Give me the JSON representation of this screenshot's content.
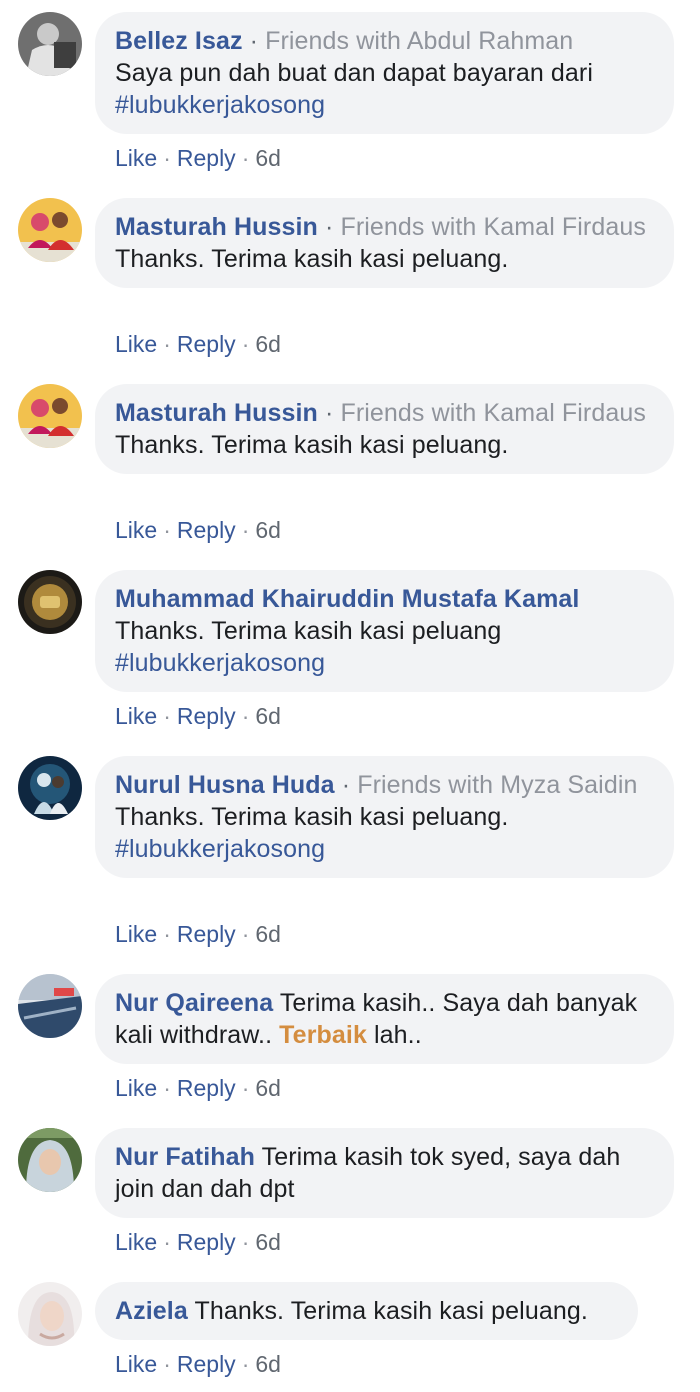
{
  "meta_separator": "·",
  "comments": [
    {
      "author": "Bellez Isaz",
      "context": "Friends with Abdul Rahman",
      "text": "Saya pun dah buat dan dapat bayaran dari",
      "hashtag": "#lubukkerjakosong",
      "like": "Like",
      "reply": "Reply",
      "time": "6d"
    },
    {
      "author": "Masturah Hussin",
      "context": "Friends with Kamal Firdaus",
      "text": "Thanks. Terima kasih kasi peluang.",
      "like": "Like",
      "reply": "Reply",
      "time": "6d"
    },
    {
      "author": "Masturah Hussin",
      "context": "Friends with Kamal Firdaus",
      "text": "Thanks. Terima kasih kasi peluang.",
      "like": "Like",
      "reply": "Reply",
      "time": "6d"
    },
    {
      "author": "Muhammad Khairuddin Mustafa Kamal",
      "text": "Thanks. Terima kasih kasi peluang",
      "hashtag": "#lubukkerjakosong",
      "like": "Like",
      "reply": "Reply",
      "time": "6d"
    },
    {
      "author": "Nurul Husna Huda",
      "context": "Friends with Myza Saidin",
      "text": "Thanks. Terima kasih kasi peluang.",
      "hashtag": "#lubukkerjakosong",
      "like": "Like",
      "reply": "Reply",
      "time": "6d"
    },
    {
      "author": "Nur Qaireena",
      "text_before": "Terima kasih.. Saya dah banyak kali withdraw..",
      "text_highlight": "Terbaik",
      "text_after": "lah..",
      "like": "Like",
      "reply": "Reply",
      "time": "6d"
    },
    {
      "author": "Nur Fatihah",
      "text": "Terima kasih tok syed, saya dah join dan dah dpt",
      "like": "Like",
      "reply": "Reply",
      "time": "6d"
    },
    {
      "author": "Aziela",
      "text": "Thanks. Terima kasih kasi peluang.",
      "like": "Like",
      "reply": "Reply",
      "time": "6d"
    }
  ]
}
